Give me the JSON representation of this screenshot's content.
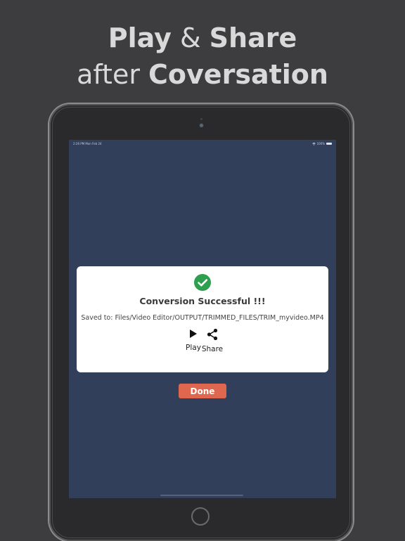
{
  "headline": {
    "line1_bold_a": "Play",
    "line1_light": " & ",
    "line1_bold_b": "Share",
    "line2_light": "after ",
    "line2_bold": "Coversation"
  },
  "status_bar": {
    "time_date": "2:26 PM  Mon Feb 24",
    "battery": "100%"
  },
  "dialog": {
    "icon": "check-circle-icon",
    "title": "Conversion Successful !!!",
    "saved_path": "Saved to: Files/Video Editor/OUTPUT/TRIMMED_FILES/TRIM_myvideo.MP4",
    "play_label": "Play",
    "share_label": "Share"
  },
  "done_label": "Done",
  "colors": {
    "background": "#3d3d3f",
    "screen": "#323f5a",
    "success_green": "#2e9e4f",
    "done_button": "#e0674f",
    "headline": "#d9d9d9"
  }
}
